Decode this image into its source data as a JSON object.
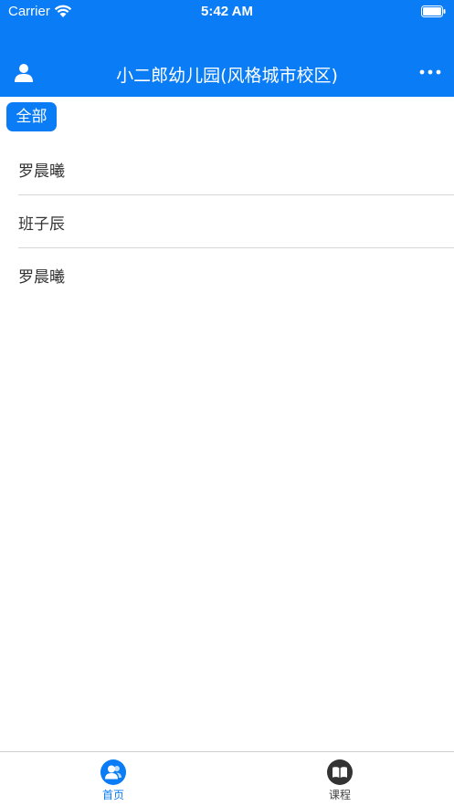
{
  "status_bar": {
    "carrier": "Carrier",
    "time": "5:42 AM"
  },
  "nav": {
    "title": "小二郎幼儿园(风格城市校区)"
  },
  "filter": {
    "label": "全部"
  },
  "list": [
    {
      "name": "罗晨曦"
    },
    {
      "name": "班子辰"
    },
    {
      "name": "罗晨曦"
    }
  ],
  "tabs": [
    {
      "label": "首页",
      "icon": "user-group-icon",
      "active": true
    },
    {
      "label": "课程",
      "icon": "book-icon",
      "active": false
    }
  ],
  "colors": {
    "accent": "#0a7cf5",
    "tab_inactive": "#444444"
  }
}
